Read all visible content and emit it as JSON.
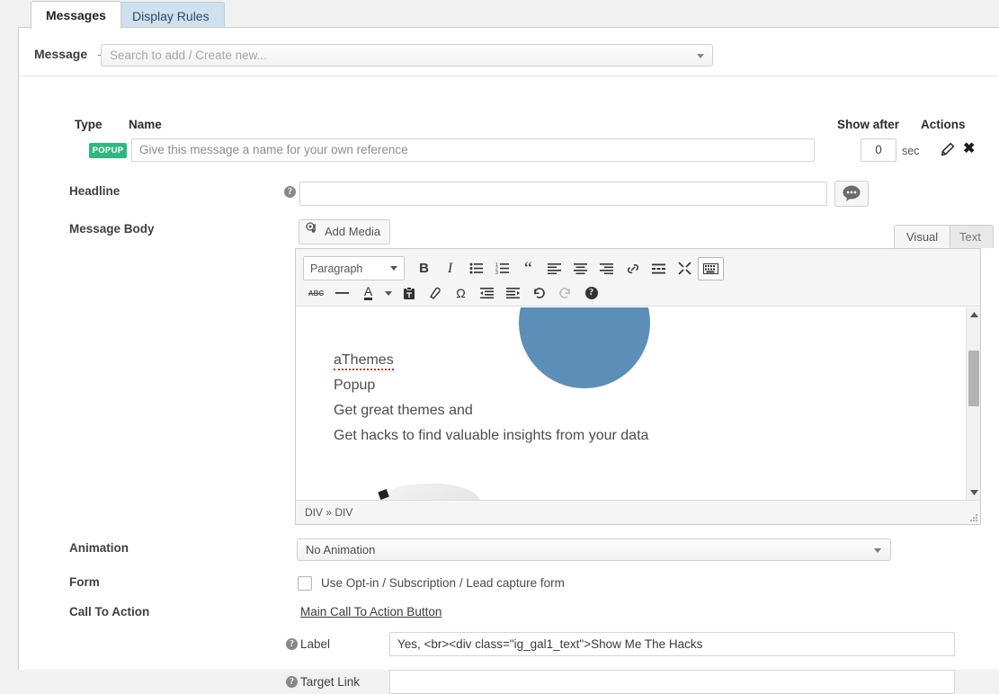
{
  "tabs": [
    {
      "label": "Messages",
      "active": true
    },
    {
      "label": "Display Rules",
      "active": false
    }
  ],
  "message_row": {
    "label": "Message",
    "select_placeholder": "Search to add / Create new..."
  },
  "table": {
    "headers": {
      "type": "Type",
      "name": "Name",
      "show_after": "Show after",
      "actions": "Actions"
    },
    "row": {
      "badge": "POPUP",
      "name_placeholder": "Give this message a name for your own reference",
      "show_after_value": "0",
      "show_after_unit": "sec"
    }
  },
  "fields": {
    "headline_label": "Headline",
    "headline_value": "",
    "message_body_label": "Message Body",
    "animation_label": "Animation",
    "animation_value": "No Animation",
    "form_label": "Form",
    "form_checkbox_label": "Use Opt-in / Subscription / Lead capture form",
    "form_checked": false,
    "cta_label": "Call To Action",
    "cta_link": "Main Call To Action Button",
    "cta_sub_label": "Label",
    "cta_sub_label_value": "Yes, <br><div class=\"ig_gal1_text\">Show Me The Hacks",
    "cta_target_label": "Target Link",
    "cta_target_value": "",
    "help_glyph": "?"
  },
  "editor": {
    "add_media": "Add Media",
    "tab_visual": "Visual",
    "tab_text": "Text",
    "format_select": "Paragraph",
    "path": "DIV » DIV",
    "toolbar_row1": [
      {
        "name": "bold-icon",
        "glyph": "B"
      },
      {
        "name": "italic-icon",
        "glyph": "I"
      },
      {
        "name": "bullet-list-icon",
        "glyph": "☰"
      },
      {
        "name": "numbered-list-icon",
        "glyph": "☰"
      },
      {
        "name": "blockquote-icon",
        "glyph": "“"
      },
      {
        "name": "align-left-icon",
        "glyph": "≡"
      },
      {
        "name": "align-center-icon",
        "glyph": "≡"
      },
      {
        "name": "align-right-icon",
        "glyph": "≡"
      },
      {
        "name": "link-icon",
        "glyph": "🔗"
      },
      {
        "name": "read-more-icon",
        "glyph": "☰"
      },
      {
        "name": "fullscreen-icon",
        "glyph": "✖"
      },
      {
        "name": "kitchen-sink-icon",
        "glyph": "⌨"
      }
    ],
    "toolbar_row2": [
      {
        "name": "strikethrough-icon",
        "glyph": "ABC"
      },
      {
        "name": "horizontal-rule-icon",
        "glyph": "—"
      },
      {
        "name": "text-color-icon",
        "glyph": "A"
      },
      {
        "name": "text-color-dropdown-icon",
        "glyph": "▾"
      },
      {
        "name": "paste-as-text-icon",
        "glyph": "📋"
      },
      {
        "name": "clear-formatting-icon",
        "glyph": "⬯"
      },
      {
        "name": "special-character-icon",
        "glyph": "Ω"
      },
      {
        "name": "outdent-icon",
        "glyph": "≡"
      },
      {
        "name": "indent-icon",
        "glyph": "≡"
      },
      {
        "name": "undo-icon",
        "glyph": "↶"
      },
      {
        "name": "redo-icon",
        "glyph": "↷"
      },
      {
        "name": "help-icon",
        "glyph": "?"
      }
    ],
    "content_lines": [
      "aThemes",
      "Popup",
      "Get great themes and",
      "Get hacks to find valuable insights from your data"
    ]
  },
  "colors": {
    "badge_green": "#2fb87e",
    "logo_blue": "#5b8fb8",
    "tab_inactive_blue": "#cfe0ee",
    "spellcheck_red": "#c0392b"
  }
}
